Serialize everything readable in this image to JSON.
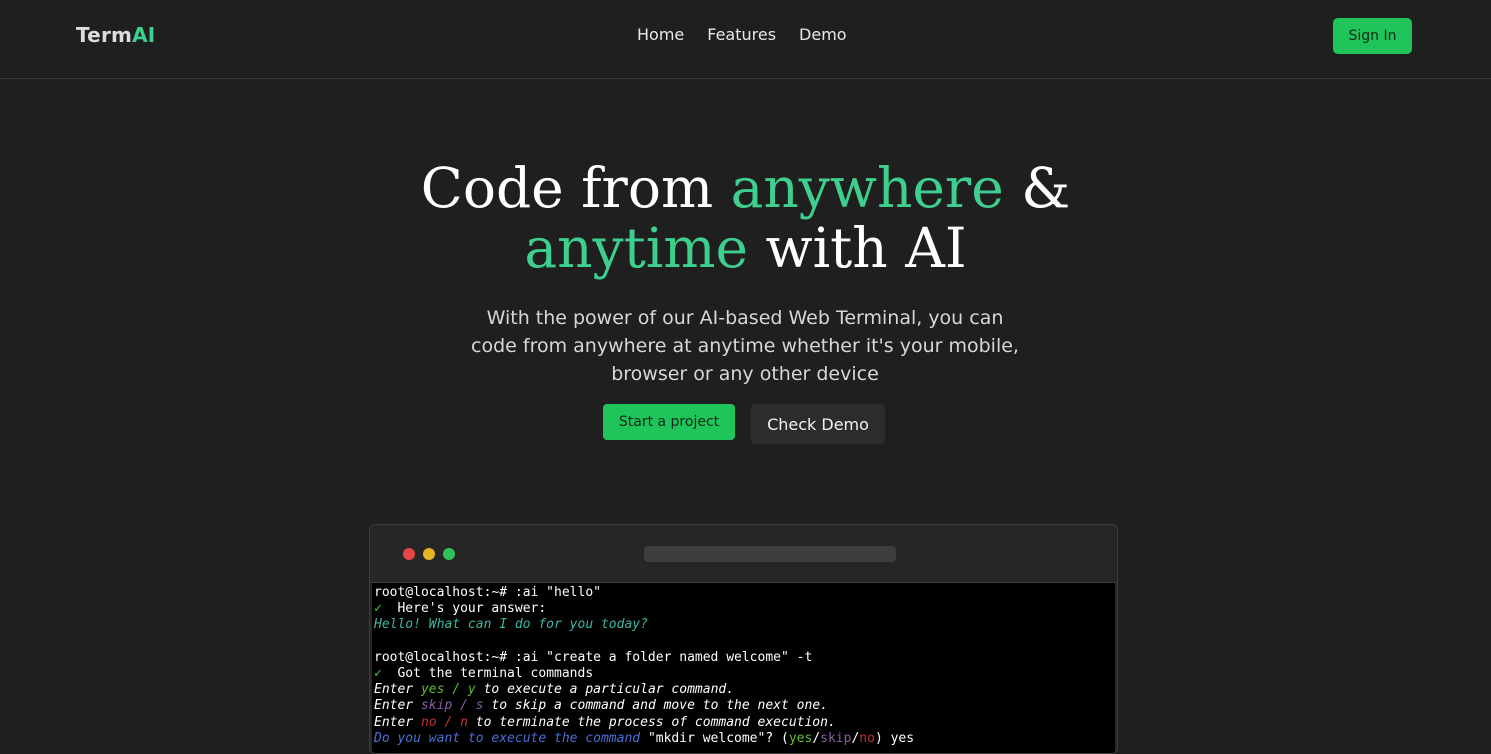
{
  "navbar": {
    "logo_main": "Term",
    "logo_accent": "AI",
    "links": [
      "Home",
      "Features",
      "Demo"
    ],
    "signin_label": "Sign In"
  },
  "hero": {
    "title_line1_a": "Code from ",
    "title_line1_accent": "anywhere",
    "title_line1_b": " &",
    "title_line2_accent": "anytime",
    "title_line2_b": " with AI",
    "subtitle": "With the power of our AI-based Web Terminal, you can code from anywhere at anytime whether it's your mobile, browser or any other device",
    "primary_button": "Start a project",
    "secondary_button": "Check Demo"
  },
  "colors": {
    "accent": "#3ecf8e",
    "button_green": "#1fc45b",
    "background": "#1f1f1f"
  },
  "terminal": {
    "window_controls": [
      "close-dot",
      "minimize-dot",
      "maximize-dot"
    ],
    "lines": {
      "l1": "root@localhost:~# :ai \"hello\"",
      "l2_check": "✓",
      "l2_text": "  Here's your answer:",
      "l3": "Hello! What can I do for you today?",
      "l5": "root@localhost:~# :ai \"create a folder named welcome\" -t",
      "l6_check": "✓",
      "l6_text": "  Got the terminal commands",
      "l7_a": "Enter ",
      "l7_opt": "yes / y",
      "l7_b": " to execute a particular command.",
      "l8_a": "Enter ",
      "l8_opt": "skip / s",
      "l8_b": " to skip a command and move to the next one.",
      "l9_a": "Enter ",
      "l9_opt": "no / n",
      "l9_b": " to terminate the process of command execution.",
      "l10_a": "Do you want to execute the command ",
      "l10_cmd": "\"mkdir welcome\"",
      "l10_q": "? (",
      "l10_yes": "yes",
      "l10_s1": "/",
      "l10_skip": "skip",
      "l10_s2": "/",
      "l10_no": "no",
      "l10_end": ") yes"
    }
  }
}
